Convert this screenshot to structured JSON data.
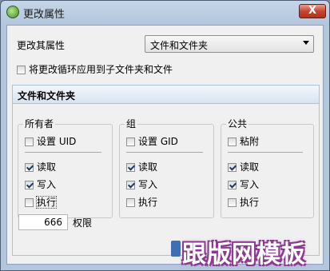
{
  "window": {
    "title": "更改属性",
    "close_label": "X"
  },
  "change_attr": {
    "label": "更改其属性",
    "selected_value": "文件和文件夹"
  },
  "apply_recursive": {
    "label": "将更改循环应用到子文件夹和文件",
    "checked": false
  },
  "section": {
    "title": "文件和文件夹"
  },
  "groups": {
    "owner": {
      "title": "所有者",
      "special_label": "设置 UID",
      "read_label": "读取",
      "write_label": "写入",
      "exec_label": "执行"
    },
    "group": {
      "title": "组",
      "special_label": "设置 GID",
      "read_label": "读取",
      "write_label": "写入",
      "exec_label": "执行"
    },
    "public": {
      "title": "公共",
      "special_label": "粘附",
      "read_label": "读取",
      "write_label": "写入",
      "exec_label": "执行"
    }
  },
  "permissions": {
    "value": "666",
    "label": "权限"
  },
  "watermark": {
    "text": "跟版网模板"
  }
}
